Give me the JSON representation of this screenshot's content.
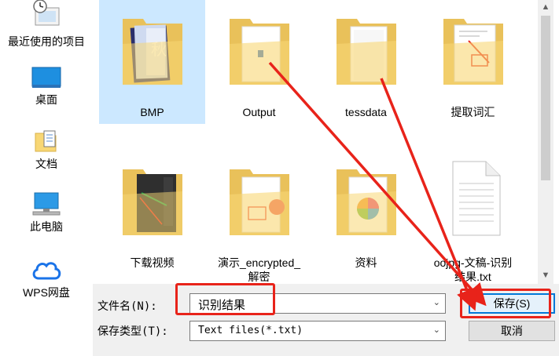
{
  "sidebar": {
    "items": [
      {
        "label": "最近使用的项目",
        "icon": "recent-items-icon"
      },
      {
        "label": "桌面",
        "icon": "desktop-icon"
      },
      {
        "label": "文档",
        "icon": "documents-icon"
      },
      {
        "label": "此电脑",
        "icon": "this-pc-icon"
      },
      {
        "label": "WPS网盘",
        "icon": "wps-cloud-icon"
      }
    ]
  },
  "files": [
    {
      "name": "BMP",
      "type": "folder",
      "selected": true
    },
    {
      "name": "Output",
      "type": "folder"
    },
    {
      "name": "tessdata",
      "type": "folder"
    },
    {
      "name": "提取词汇",
      "type": "folder"
    },
    {
      "name": "下载视频",
      "type": "folder"
    },
    {
      "name": "演示_encrypted_",
      "name_line2": "解密",
      "type": "folder"
    },
    {
      "name": "资料",
      "type": "folder"
    },
    {
      "name": "oojpg-文稿-识别",
      "name_line2": "结果.txt",
      "type": "text-file"
    }
  ],
  "form": {
    "filename_label": "文件名(N):",
    "filename_value": "识别结果",
    "filetype_label": "保存类型(T):",
    "filetype_value": "Text files(*.txt)",
    "save_label": "保存(S)",
    "cancel_label": "取消"
  },
  "colors": {
    "selection": "#cce8ff",
    "annotation_red": "#e8231a",
    "folder_yellow": "#f8d775",
    "default_button_border": "#0078d7"
  }
}
